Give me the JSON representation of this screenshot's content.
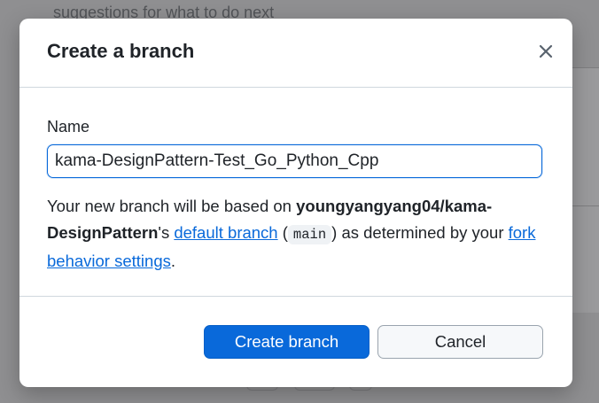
{
  "background": {
    "partial_text": "suggestions for what to do next"
  },
  "dialog": {
    "title": "Create a branch",
    "close_icon": "close-icon",
    "name_label": "Name",
    "name_value": "kama-DesignPattern-Test_Go_Python_Cpp",
    "description": {
      "prefix": "Your new branch will be based on ",
      "repo": "youngyangyang04/kama-DesignPattern",
      "possessive": "'s ",
      "default_branch_link": "default branch",
      "open_paren": " (",
      "branch_code": "main",
      "close_paren": ") as determined by your ",
      "fork_settings_link": "fork behavior settings",
      "suffix": "."
    },
    "create_button": "Create branch",
    "cancel_button": "Cancel"
  },
  "colors": {
    "accent": "#0969da",
    "text": "#1f2328",
    "border": "#d0d7de"
  }
}
